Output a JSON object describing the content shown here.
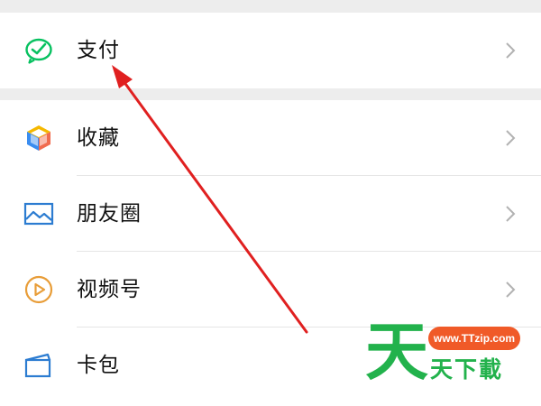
{
  "menu": {
    "pay": {
      "label": "支付",
      "icon": "wechat-pay-icon",
      "color": "#07c160"
    },
    "items": [
      {
        "label": "收藏",
        "icon": "favorites-cube-icon"
      },
      {
        "label": "朋友圈",
        "icon": "moments-image-icon",
        "color": "#2c7cd1"
      },
      {
        "label": "视频号",
        "icon": "channels-play-icon",
        "color": "#e89d38"
      },
      {
        "label": "卡包",
        "icon": "card-wallet-icon",
        "color": "#2c7cd1"
      }
    ]
  },
  "annotation": {
    "arrow_color": "#e02020",
    "points_to": "支付"
  },
  "watermark": {
    "big": "天",
    "url": "www.TTzip.com",
    "small": "天下載",
    "green": "#22b24c",
    "orange": "#f05a28"
  }
}
